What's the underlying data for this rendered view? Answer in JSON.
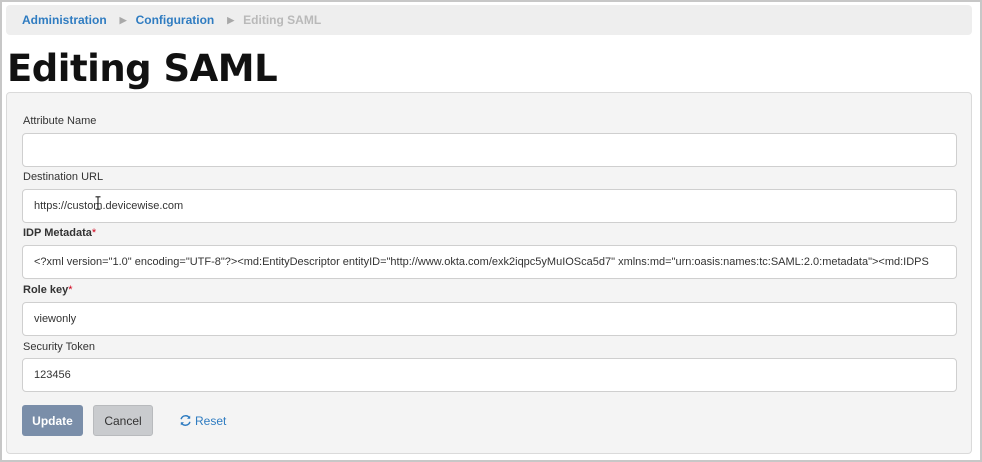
{
  "breadcrumb": {
    "items": [
      "Administration",
      "Configuration"
    ],
    "current": "Editing SAML"
  },
  "page": {
    "title": "Editing SAML"
  },
  "form": {
    "attribute_name": {
      "label": "Attribute Name",
      "value": ""
    },
    "destination_url": {
      "label": "Destination URL",
      "value": "https://custom.devicewise.com"
    },
    "idp_metadata": {
      "label": "IDP Metadata",
      "required_mark": "*",
      "value": "<?xml version=\"1.0\" encoding=\"UTF-8\"?><md:EntityDescriptor entityID=\"http://www.okta.com/exk2iqpc5yMuIOSca5d7\" xmlns:md=\"urn:oasis:names:tc:SAML:2.0:metadata\"><md:IDPS"
    },
    "role_key": {
      "label": "Role key",
      "required_mark": "*",
      "value": "viewonly"
    },
    "security_token": {
      "label": "Security Token",
      "value": "123456"
    }
  },
  "actions": {
    "update_label": "Update",
    "cancel_label": "Cancel",
    "reset_label": "Reset"
  },
  "icons": {
    "breadcrumb_separator": "triangle-right-icon",
    "reset": "refresh-icon",
    "text_cursor": "i-beam-cursor-icon"
  },
  "colors": {
    "link": "#2f7cc1",
    "required": "#d0021b",
    "primary_button": "#7a8ea9",
    "secondary_button": "#c9cbce"
  }
}
